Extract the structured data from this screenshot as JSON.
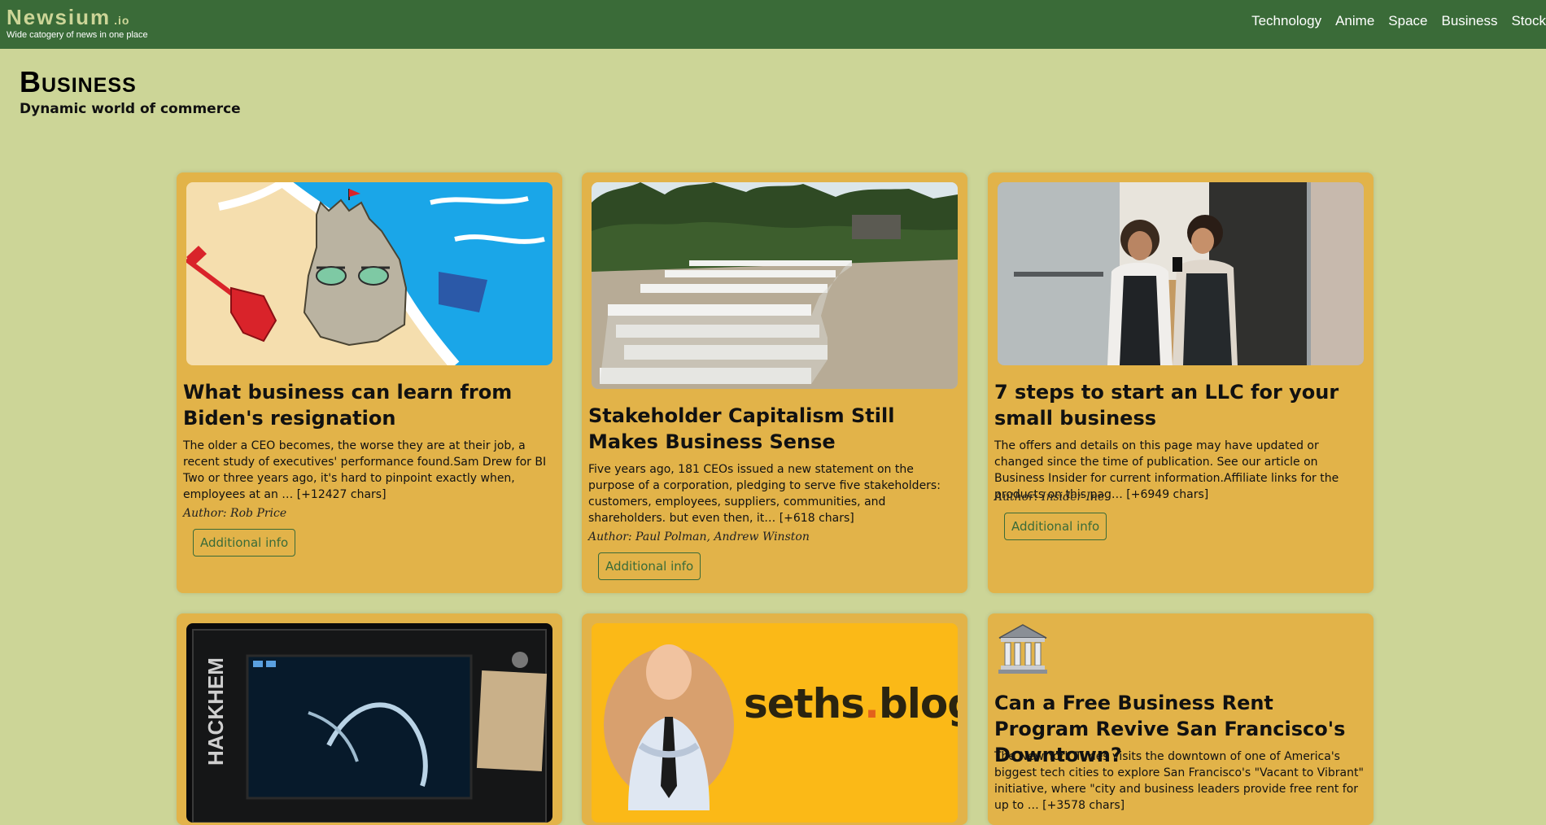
{
  "navbar": {
    "brand_name": "Newsium",
    "brand_tld": ".io",
    "tagline": "Wide catogery of news in one place",
    "links": [
      "Technology",
      "Anime",
      "Space",
      "Business",
      "Stock"
    ]
  },
  "header": {
    "title": "Business",
    "subtitle": "Dynamic world of commerce"
  },
  "articles": [
    {
      "title": "What business can learn from Biden's resignation",
      "description": "The older a CEO becomes, the worse they are at their job, a recent study of executives' performance found.Sam Drew for BI Two or three years ago, it's hard to pinpoint exactly when, employees at an … [+12427 chars]",
      "author": "Author: Rob Price",
      "button": "Additional info",
      "image": "sandcastle-illustration"
    },
    {
      "title": "Stakeholder Capitalism Still Makes Business Sense",
      "description": "Five years ago, 181 CEOs issued a new statement on the purpose of a corporation, pledging to serve five stakeholders: customers, employees, suppliers, communities, and shareholders. but even then, it… [+618 chars]",
      "author": "Author: Paul Polman, Andrew Winston",
      "button": "Additional info",
      "image": "rows-of-white-chairs-photo"
    },
    {
      "title": "7 steps to start an LLC for your small business",
      "description": "The offers and details on this page may have updated or changed since the time of publication. See our article on Business Insider for current information.Affiliate links for the products on this pag… [+6949 chars]",
      "author": "Author: Insider Inc.",
      "button": "Additional info",
      "image": "shop-owners-photo"
    },
    {
      "title": "",
      "description": "",
      "author": "",
      "button": "",
      "image": "hacker-laptop-photo"
    },
    {
      "title": "",
      "description": "",
      "author": "",
      "button": "",
      "image": "seths-blog-banner",
      "logo_text_1": "seths",
      "logo_text_2": "blog"
    },
    {
      "title": "Can a Free Business Rent Program Revive San Francisco's Downtown?",
      "description": "The New York Times visits the downtown of one of America's biggest tech cities to explore San Francisco's \"Vacant to Vibrant\" initiative, where \"city and business leaders provide free rent for up to … [+3578 chars]",
      "author": "",
      "button": "",
      "image": "bank-building-icon"
    }
  ],
  "colors": {
    "navbar": "#3a6b38",
    "background": "#ccd597",
    "card": "#e2b349",
    "accent": "#3a6b38"
  }
}
